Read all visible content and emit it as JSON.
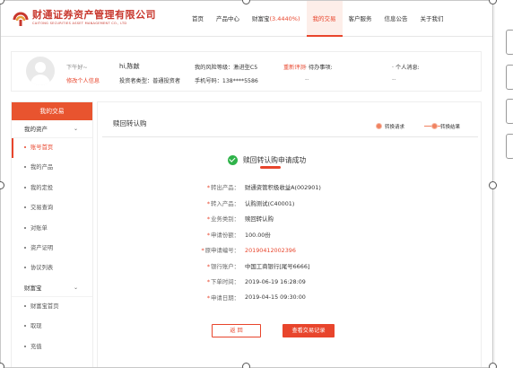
{
  "header": {
    "logo_cn": "财通证券资产管理有限公司",
    "logo_en": "CAITONG SECURITIES ASSET MANAGEMENT CO., LTD",
    "nav": [
      {
        "label": "首页"
      },
      {
        "label": "产品中心"
      },
      {
        "label": "财富宝",
        "extra": "(3.4440%)"
      },
      {
        "label": "我的交易",
        "active": true
      },
      {
        "label": "客户服务"
      },
      {
        "label": "信息公告"
      },
      {
        "label": "关于我们"
      }
    ]
  },
  "userbar": {
    "greeting": "下午好~",
    "name": "hi,陈献",
    "edit_link": "修改个人信息",
    "risk_label": "我的风险等级：激进型C5",
    "reassess_link": "重新评测",
    "investor_type": "投资者类型：普通投资者",
    "phone": "手机号码：138****5586",
    "todo_label": "待办事项:",
    "todo_value": "--",
    "msg_label": "个人消息:",
    "msg_value": "--"
  },
  "sidebar": {
    "header": "我的交易",
    "groups": [
      {
        "label": "我的资产",
        "items": [
          {
            "label": "账号首页",
            "active": true
          },
          {
            "label": "我的产品"
          },
          {
            "label": "我的定投"
          },
          {
            "label": "交易查询"
          },
          {
            "label": "对账单"
          },
          {
            "label": "资产证明"
          },
          {
            "label": "协议列表"
          }
        ]
      },
      {
        "label": "财富宝",
        "items": [
          {
            "label": "财富宝首页"
          },
          {
            "label": "取现"
          },
          {
            "label": "充值"
          }
        ]
      }
    ]
  },
  "content": {
    "title": "赎回转认购",
    "steps": [
      "转换请求",
      "转换结果"
    ],
    "success_msg": "赎回转认购申请成功",
    "rows": [
      {
        "label": "转出产品：",
        "value": "财通资管积极收益A(002901)"
      },
      {
        "label": "转入产品：",
        "value": "认购测试(C40001)"
      },
      {
        "label": "业务类别：",
        "value": "赎回转认购"
      },
      {
        "label": "申请份额：",
        "value": "100.00份"
      },
      {
        "label": "原申请编号：",
        "value": "20190412002396",
        "red": true
      },
      {
        "label": "银行账户：",
        "value": "中国工商银行[尾号6666]"
      },
      {
        "label": "下单时间：",
        "value": "2019-06-19 16:28:09"
      },
      {
        "label": "申请日期：",
        "value": "2019-04-15 09:30:00"
      }
    ],
    "back_button": "返 回",
    "record_button": "查看交易记录"
  },
  "colors": {
    "accent": "#e8452c",
    "success": "#2fb34a"
  },
  "icons": [
    "logo-icon",
    "avatar-icon",
    "success-check-icon",
    "chevron-down-icon"
  ]
}
